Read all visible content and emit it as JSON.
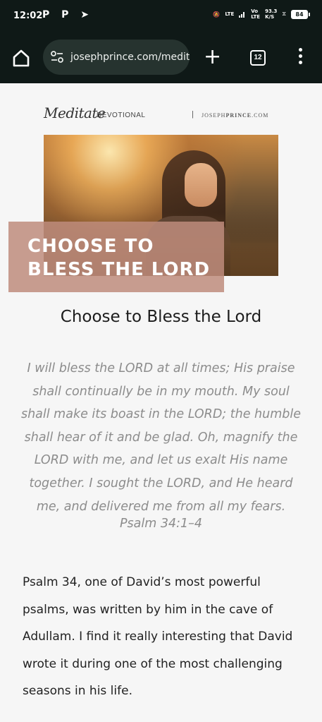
{
  "status_bar": {
    "time": "12:02",
    "left_icons": "P P",
    "net1": "LTE",
    "net2": "Vo",
    "net3": "LTE",
    "speed": "93.3",
    "speed_unit": "K/S",
    "battery": "84"
  },
  "toolbar": {
    "url": "josephprince.com/medit",
    "tab_count": "12"
  },
  "page": {
    "brand_script": "Meditate",
    "brand_devotional": "DEVOTIONAL",
    "brand_separator": "|",
    "brand_site_prefix": "JOSEPH",
    "brand_site_bold": "PRINCE",
    "brand_site_suffix": ".COM",
    "hero_title_line1": "CHOOSE TO",
    "hero_title_line2": "BLESS THE LORD",
    "heading": "Choose to Bless the Lord",
    "verse": "I will bless the LORD at all times; His praise shall continually be in my mouth. My soul shall make its boast in the LORD; the humble shall hear of it and be glad. Oh, magnify the LORD with me, and let us exalt His name together. I sought the LORD, and He heard me, and delivered me from all my fears.",
    "verse_reference": "Psalm 34:1–4",
    "body_paragraph": "Psalm 34, one of David’s most powerful psalms, was written by him in the cave of Adullam. I find it really interesting that David wrote it during one of the most challenging seasons in his life."
  },
  "colors": {
    "chrome": "#0f1917",
    "url_bar": "#26332f",
    "title_overlay": "#be8c7d",
    "verse_text": "#8c8c8c"
  }
}
